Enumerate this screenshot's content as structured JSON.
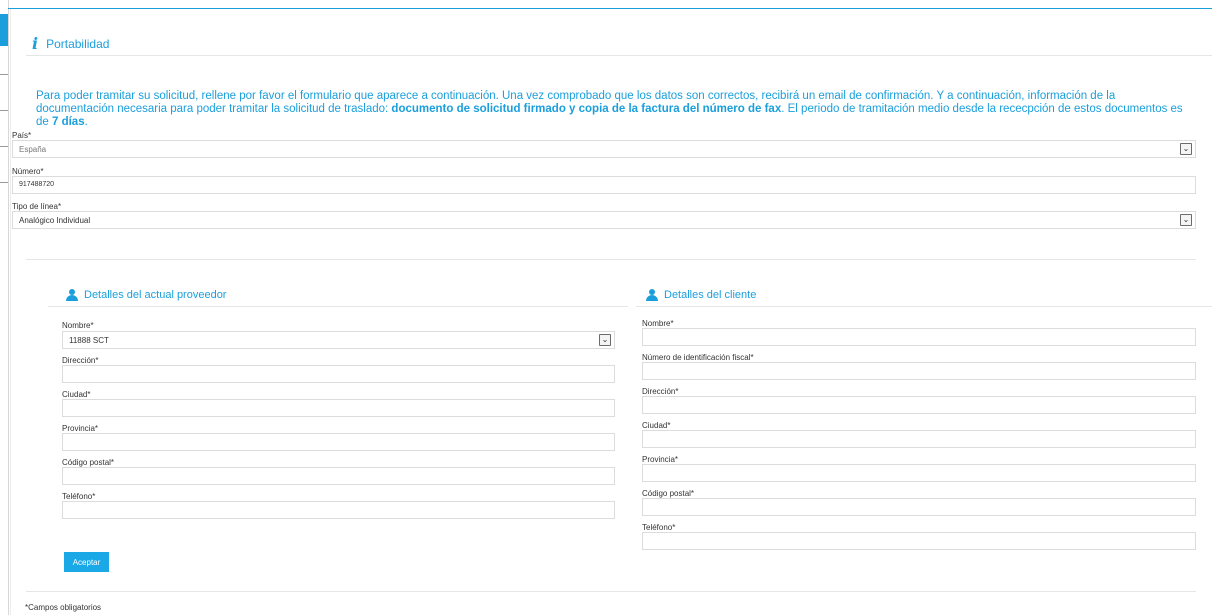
{
  "section": {
    "icon": "info-icon",
    "title": "Portabilidad"
  },
  "intro": {
    "part1": "Para poder tramitar su solicitud, rellene por favor el formulario que aparece a continuación. Una vez comprobado que los datos son correctos, recibirá un email de confirmación. Y a continuación, información de la documentación necesaria para poder tramitar la solicitud de traslado: ",
    "bold1": "documento de solicitud firmado y copia de la factura del número de fax",
    "part2": ". El periodo de tramitación medio desde la rececpción de estos documentos es de ",
    "bold2": "7 días",
    "part3": "."
  },
  "form": {
    "pais": {
      "label": "País*",
      "value": "España"
    },
    "numero": {
      "label": "Número*",
      "value": "917488720"
    },
    "tipo": {
      "label": "Tipo de línea*",
      "value": "Analógico Individual"
    }
  },
  "proveedor": {
    "title": "Detalles del actual proveedor",
    "nombre": {
      "label": "Nombre*",
      "value": "11888 SCT"
    },
    "direccion": {
      "label": "Dirección*",
      "value": ""
    },
    "ciudad": {
      "label": "Ciudad*",
      "value": ""
    },
    "provincia": {
      "label": "Provincia*",
      "value": ""
    },
    "codigo_postal": {
      "label": "Código postal*",
      "value": ""
    },
    "telefono": {
      "label": "Teléfono*",
      "value": ""
    }
  },
  "cliente": {
    "title": "Detalles del cliente",
    "nombre": {
      "label": "Nombre*",
      "value": ""
    },
    "nif": {
      "label": "Número de identificación fiscal*",
      "value": ""
    },
    "direccion": {
      "label": "Dirección*",
      "value": ""
    },
    "ciudad": {
      "label": "Ciudad*",
      "value": ""
    },
    "provincia": {
      "label": "Provincia*",
      "value": ""
    },
    "codigo_postal": {
      "label": "Código postal*",
      "value": ""
    },
    "telefono": {
      "label": "Teléfono*",
      "value": ""
    }
  },
  "buttons": {
    "accept": "Aceptar"
  },
  "footer": {
    "note": "*Campos obligatorios"
  },
  "colors": {
    "accent": "#1a9fdc",
    "button": "#1aa9e6"
  }
}
